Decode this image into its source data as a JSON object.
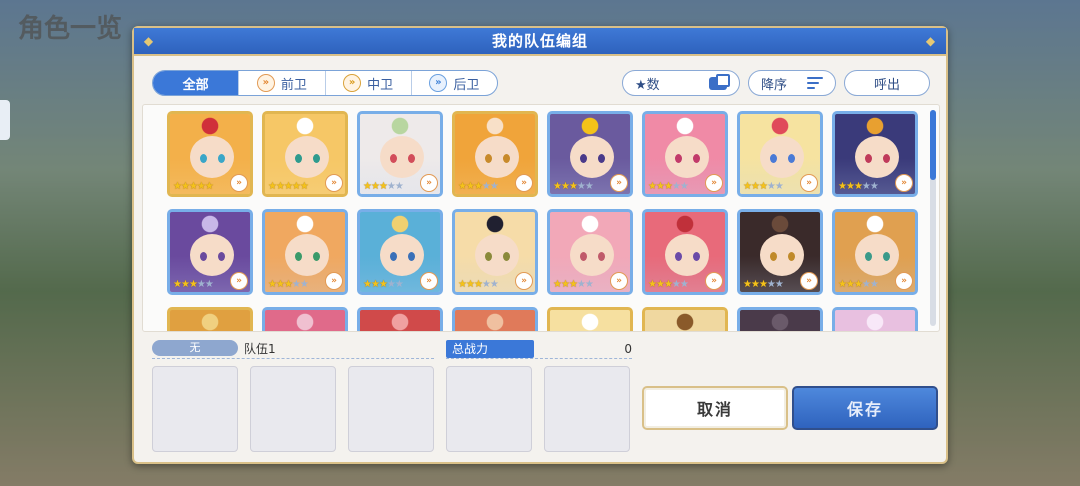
{
  "background": {
    "title": "角色一览"
  },
  "dialog": {
    "title": "我的队伍编组",
    "filters": [
      {
        "label": "全部",
        "icon": "",
        "active": true
      },
      {
        "label": "前卫",
        "icon": "front-chevron-icon",
        "active": false
      },
      {
        "label": "中卫",
        "icon": "middle-chevron-icon",
        "active": false
      },
      {
        "label": "后卫",
        "icon": "back-chevron-icon",
        "active": false
      }
    ],
    "sort_label": "★数",
    "order_label": "降序",
    "call_label": "呼出",
    "characters": [
      {
        "stars": 5,
        "frame": "gold",
        "hair": "#f3b04a",
        "eyes": "#3aa6c8",
        "accent": "#d0303a"
      },
      {
        "stars": 5,
        "frame": "gold",
        "hair": "#f6c766",
        "eyes": "#2e9b8e",
        "accent": "#ffffff"
      },
      {
        "stars": 3,
        "frame": "blue",
        "hair": "#eeeaea",
        "eyes": "#d24d5a",
        "accent": "#b8d6a0"
      },
      {
        "stars": 3,
        "frame": "gold",
        "hair": "#f0a43a",
        "eyes": "#c88a2a",
        "accent": "#f8e0c8"
      },
      {
        "stars": 3,
        "frame": "blue",
        "hair": "#6a5a9e",
        "eyes": "#4a3a8a",
        "accent": "#f4c21a"
      },
      {
        "stars": 3,
        "frame": "blue",
        "hair": "#f08aa6",
        "eyes": "#c23a6a",
        "accent": "#ffffff"
      },
      {
        "stars": 3,
        "frame": "blue",
        "hair": "#f6e3a0",
        "eyes": "#4a7ad6",
        "accent": "#e04a5a"
      },
      {
        "stars": 3,
        "frame": "blue",
        "hair": "#3a3a7a",
        "eyes": "#c03a5a",
        "accent": "#e8a030"
      },
      {
        "stars": 3,
        "frame": "blue",
        "hair": "#6a4a9e",
        "eyes": "#6a4a9e",
        "accent": "#c8b8e8"
      },
      {
        "stars": 3,
        "frame": "blue",
        "hair": "#f0a860",
        "eyes": "#3a9a6a",
        "accent": "#ffffff"
      },
      {
        "stars": 3,
        "frame": "blue",
        "hair": "#5ab0d8",
        "eyes": "#3a70b8",
        "accent": "#f0d070"
      },
      {
        "stars": 3,
        "frame": "blue",
        "hair": "#f6dca8",
        "eyes": "#8a8a3a",
        "accent": "#202030"
      },
      {
        "stars": 3,
        "frame": "blue",
        "hair": "#f2a8b8",
        "eyes": "#c05a6a",
        "accent": "#ffffff"
      },
      {
        "stars": 3,
        "frame": "blue",
        "hair": "#e86a7a",
        "eyes": "#6a4aa8",
        "accent": "#c0303a"
      },
      {
        "stars": 3,
        "frame": "blue",
        "hair": "#3a2a2a",
        "eyes": "#c08a2a",
        "accent": "#6a4a3a"
      },
      {
        "stars": 3,
        "frame": "blue",
        "hair": "#e0a050",
        "eyes": "#3a9a8a",
        "accent": "#ffffff"
      },
      {
        "stars": 0,
        "frame": "gold",
        "hair": "#e0a040",
        "eyes": "#c0803a",
        "accent": "#f0d080"
      },
      {
        "stars": 0,
        "frame": "blue",
        "hair": "#e06a8a",
        "eyes": "#a03a5a",
        "accent": "#f0c0d0"
      },
      {
        "stars": 0,
        "frame": "blue",
        "hair": "#d04a4a",
        "eyes": "#8a2a2a",
        "accent": "#f0a0a0"
      },
      {
        "stars": 0,
        "frame": "blue",
        "hair": "#e07a5a",
        "eyes": "#a04a3a",
        "accent": "#f0c0a0"
      },
      {
        "stars": 0,
        "frame": "gold",
        "hair": "#f6e0a0",
        "eyes": "#c0a040",
        "accent": "#ffffff"
      },
      {
        "stars": 0,
        "frame": "gold",
        "hair": "#f0d8a0",
        "eyes": "#c09040",
        "accent": "#8a5a2a"
      },
      {
        "stars": 0,
        "frame": "blue",
        "hair": "#4a3a4a",
        "eyes": "#2a2a3a",
        "accent": "#6a5a6a"
      },
      {
        "stars": 0,
        "frame": "blue",
        "hair": "#e8c0e0",
        "eyes": "#b08ac0",
        "accent": "#f8e8f8"
      }
    ],
    "team": {
      "label": "无",
      "name": "队伍1",
      "power_label": "总战力",
      "power_value": "0",
      "slots": 5
    },
    "cancel_label": "取消",
    "save_label": "保存"
  },
  "colors": {
    "header_blue": "#2e62bd",
    "accent_blue": "#3b78d8",
    "gold_border": "#d9c088"
  }
}
